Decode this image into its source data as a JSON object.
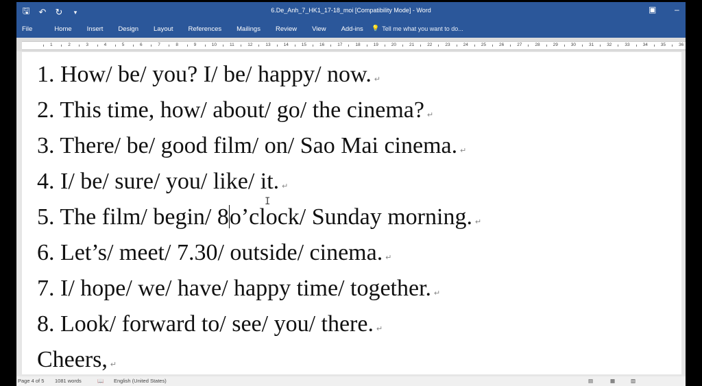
{
  "titlebar": {
    "qat_icons": [
      "save-icon",
      "undo-icon",
      "redo-icon",
      "customize-icon"
    ],
    "document_title": "6.De_Anh_7_HK1_17-18_moi [Compatibility Mode] - Word"
  },
  "ribbon": {
    "tabs": [
      "File",
      "Home",
      "Insert",
      "Design",
      "Layout",
      "References",
      "Mailings",
      "Review",
      "View",
      "Add-ins"
    ],
    "tell_me_placeholder": "Tell me what you want to do..."
  },
  "ruler": {
    "numbers": [
      "1",
      "2",
      "3",
      "4",
      "5",
      "6",
      "7",
      "8",
      "9",
      "10",
      "11",
      "12",
      "13",
      "14",
      "15",
      "16",
      "17",
      "18",
      "19",
      "20",
      "21",
      "22",
      "23",
      "24",
      "25",
      "26",
      "27",
      "28",
      "29",
      "30",
      "31",
      "32",
      "33",
      "34",
      "35",
      "36"
    ]
  },
  "document": {
    "lines": [
      "1. How/ be/ you? I/ be/ happy/ now.",
      "2. This time, how/ about/ go/ the cinema?",
      "3. There/ be/ good film/ on/ Sao Mai cinema.",
      "4. I/ be/ sure/ you/ like/ it.",
      "5. The film/ begin/ 8",
      "6. Let’s/ meet/ 7.30/ outside/ cinema.",
      "7. I/ hope/ we/ have/ happy time/ together.",
      "8. Look/ forward to/ see/ you/ there.",
      "Cheers,"
    ],
    "line5_after_cursor": "o’clock/ Sunday morning.",
    "paragraph_mark": "↵"
  },
  "statusbar": {
    "page": "Page 4 of 5",
    "words": "1081 words",
    "language": "English (United States)"
  },
  "colors": {
    "ribbon": "#2b579a"
  }
}
